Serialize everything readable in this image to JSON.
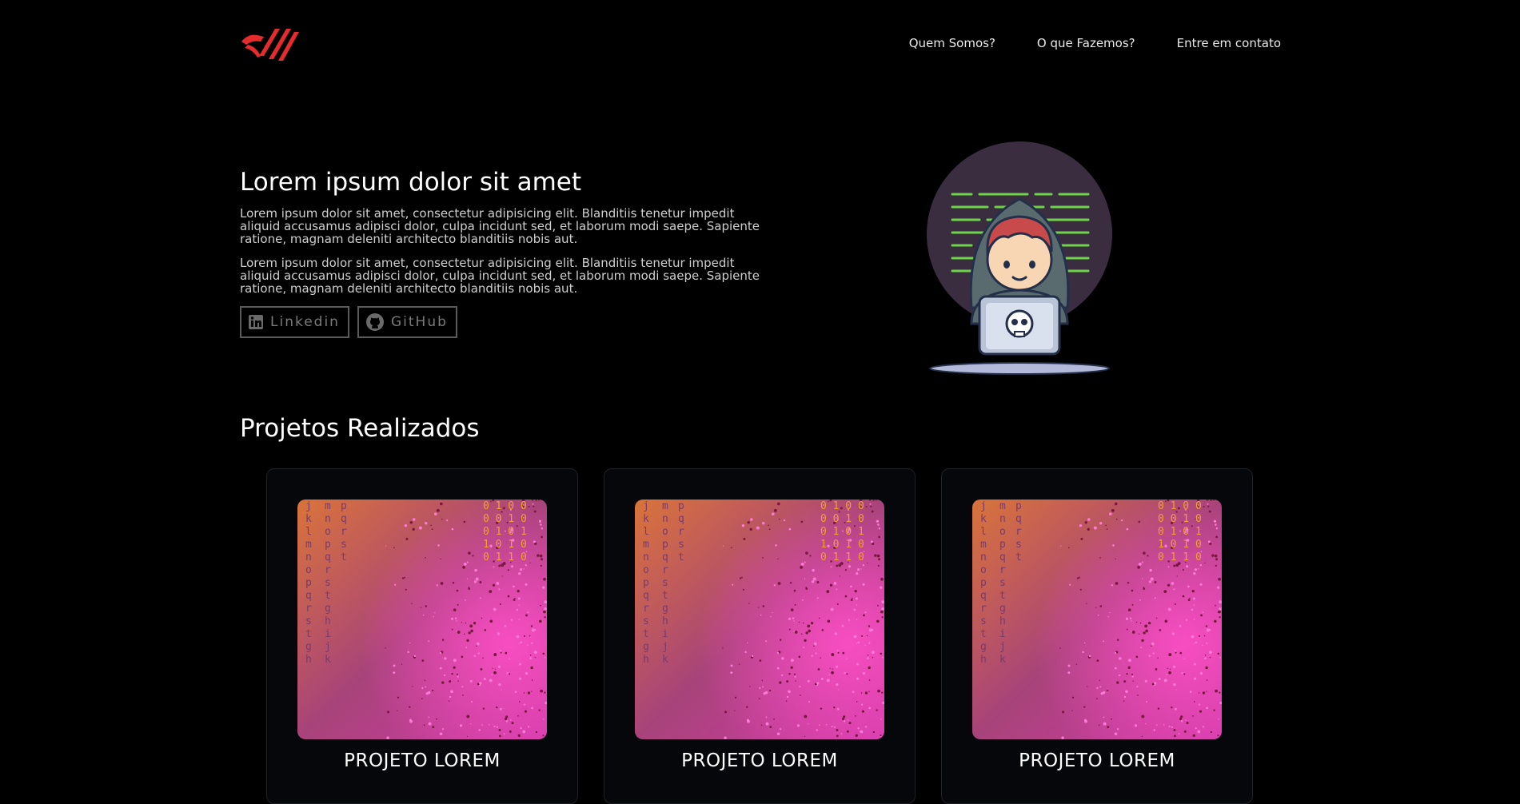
{
  "header": {
    "nav": [
      {
        "label": "Quem Somos?"
      },
      {
        "label": "O que Fazemos?"
      },
      {
        "label": "Entre em contato"
      }
    ]
  },
  "hero": {
    "title": "Lorem ipsum dolor sit amet",
    "paragraphs": [
      "Lorem ipsum dolor sit amet, consectetur adipisicing elit. Blanditiis tenetur impedit aliquid accusamus adipisci dolor, culpa incidunt sed, et laborum modi saepe. Sapiente ratione, magnam deleniti architecto blanditiis nobis aut.",
      "Lorem ipsum dolor sit amet, consectetur adipisicing elit. Blanditiis tenetur impedit aliquid accusamus adipisci dolor, culpa incidunt sed, et laborum modi saepe. Sapiente ratione, magnam deleniti architecto blanditiis nobis aut."
    ],
    "social": [
      {
        "label": "Linkedin",
        "icon": "linkedin-icon"
      },
      {
        "label": "GitHub",
        "icon": "github-icon"
      }
    ]
  },
  "projects": {
    "title": "Projetos Realizados",
    "cards": [
      {
        "title": "PROJETO LOREM"
      },
      {
        "title": "PROJETO LOREM"
      },
      {
        "title": "PROJETO LOREM"
      }
    ]
  },
  "colors": {
    "background": "#000000",
    "accent": "#e52b2b",
    "card_bg": "#06070a",
    "card_border": "#1e2126"
  }
}
